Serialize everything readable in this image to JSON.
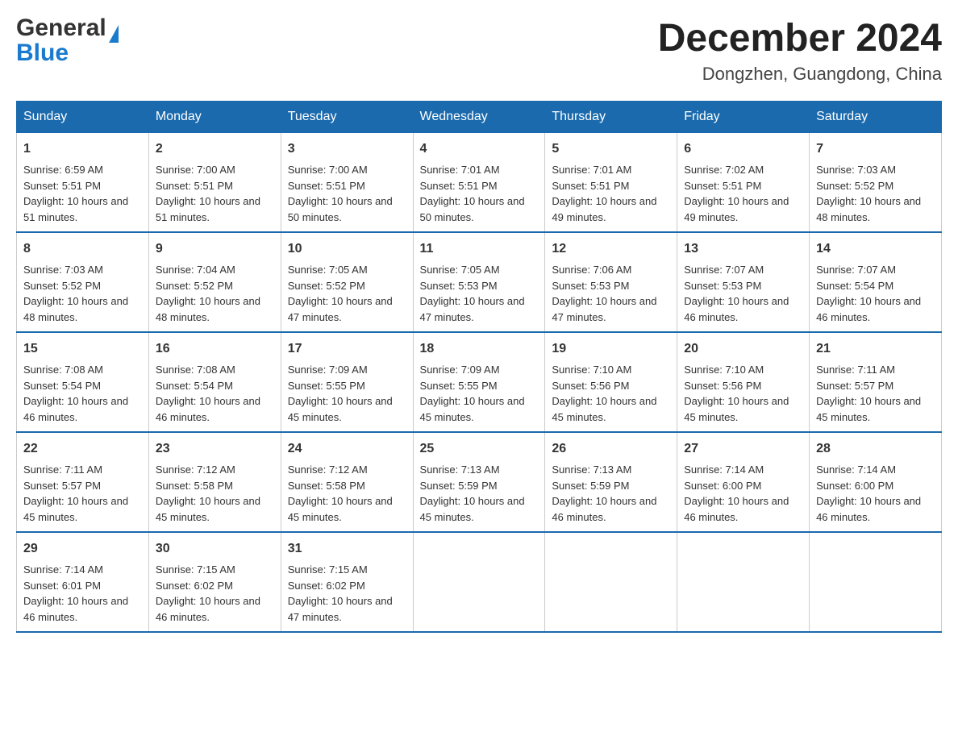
{
  "header": {
    "month_title": "December 2024",
    "location": "Dongzhen, Guangdong, China",
    "logo_general": "General",
    "logo_blue": "Blue"
  },
  "days_of_week": [
    "Sunday",
    "Monday",
    "Tuesday",
    "Wednesday",
    "Thursday",
    "Friday",
    "Saturday"
  ],
  "weeks": [
    [
      {
        "day": "1",
        "sunrise": "Sunrise: 6:59 AM",
        "sunset": "Sunset: 5:51 PM",
        "daylight": "Daylight: 10 hours and 51 minutes."
      },
      {
        "day": "2",
        "sunrise": "Sunrise: 7:00 AM",
        "sunset": "Sunset: 5:51 PM",
        "daylight": "Daylight: 10 hours and 51 minutes."
      },
      {
        "day": "3",
        "sunrise": "Sunrise: 7:00 AM",
        "sunset": "Sunset: 5:51 PM",
        "daylight": "Daylight: 10 hours and 50 minutes."
      },
      {
        "day": "4",
        "sunrise": "Sunrise: 7:01 AM",
        "sunset": "Sunset: 5:51 PM",
        "daylight": "Daylight: 10 hours and 50 minutes."
      },
      {
        "day": "5",
        "sunrise": "Sunrise: 7:01 AM",
        "sunset": "Sunset: 5:51 PM",
        "daylight": "Daylight: 10 hours and 49 minutes."
      },
      {
        "day": "6",
        "sunrise": "Sunrise: 7:02 AM",
        "sunset": "Sunset: 5:51 PM",
        "daylight": "Daylight: 10 hours and 49 minutes."
      },
      {
        "day": "7",
        "sunrise": "Sunrise: 7:03 AM",
        "sunset": "Sunset: 5:52 PM",
        "daylight": "Daylight: 10 hours and 48 minutes."
      }
    ],
    [
      {
        "day": "8",
        "sunrise": "Sunrise: 7:03 AM",
        "sunset": "Sunset: 5:52 PM",
        "daylight": "Daylight: 10 hours and 48 minutes."
      },
      {
        "day": "9",
        "sunrise": "Sunrise: 7:04 AM",
        "sunset": "Sunset: 5:52 PM",
        "daylight": "Daylight: 10 hours and 48 minutes."
      },
      {
        "day": "10",
        "sunrise": "Sunrise: 7:05 AM",
        "sunset": "Sunset: 5:52 PM",
        "daylight": "Daylight: 10 hours and 47 minutes."
      },
      {
        "day": "11",
        "sunrise": "Sunrise: 7:05 AM",
        "sunset": "Sunset: 5:53 PM",
        "daylight": "Daylight: 10 hours and 47 minutes."
      },
      {
        "day": "12",
        "sunrise": "Sunrise: 7:06 AM",
        "sunset": "Sunset: 5:53 PM",
        "daylight": "Daylight: 10 hours and 47 minutes."
      },
      {
        "day": "13",
        "sunrise": "Sunrise: 7:07 AM",
        "sunset": "Sunset: 5:53 PM",
        "daylight": "Daylight: 10 hours and 46 minutes."
      },
      {
        "day": "14",
        "sunrise": "Sunrise: 7:07 AM",
        "sunset": "Sunset: 5:54 PM",
        "daylight": "Daylight: 10 hours and 46 minutes."
      }
    ],
    [
      {
        "day": "15",
        "sunrise": "Sunrise: 7:08 AM",
        "sunset": "Sunset: 5:54 PM",
        "daylight": "Daylight: 10 hours and 46 minutes."
      },
      {
        "day": "16",
        "sunrise": "Sunrise: 7:08 AM",
        "sunset": "Sunset: 5:54 PM",
        "daylight": "Daylight: 10 hours and 46 minutes."
      },
      {
        "day": "17",
        "sunrise": "Sunrise: 7:09 AM",
        "sunset": "Sunset: 5:55 PM",
        "daylight": "Daylight: 10 hours and 45 minutes."
      },
      {
        "day": "18",
        "sunrise": "Sunrise: 7:09 AM",
        "sunset": "Sunset: 5:55 PM",
        "daylight": "Daylight: 10 hours and 45 minutes."
      },
      {
        "day": "19",
        "sunrise": "Sunrise: 7:10 AM",
        "sunset": "Sunset: 5:56 PM",
        "daylight": "Daylight: 10 hours and 45 minutes."
      },
      {
        "day": "20",
        "sunrise": "Sunrise: 7:10 AM",
        "sunset": "Sunset: 5:56 PM",
        "daylight": "Daylight: 10 hours and 45 minutes."
      },
      {
        "day": "21",
        "sunrise": "Sunrise: 7:11 AM",
        "sunset": "Sunset: 5:57 PM",
        "daylight": "Daylight: 10 hours and 45 minutes."
      }
    ],
    [
      {
        "day": "22",
        "sunrise": "Sunrise: 7:11 AM",
        "sunset": "Sunset: 5:57 PM",
        "daylight": "Daylight: 10 hours and 45 minutes."
      },
      {
        "day": "23",
        "sunrise": "Sunrise: 7:12 AM",
        "sunset": "Sunset: 5:58 PM",
        "daylight": "Daylight: 10 hours and 45 minutes."
      },
      {
        "day": "24",
        "sunrise": "Sunrise: 7:12 AM",
        "sunset": "Sunset: 5:58 PM",
        "daylight": "Daylight: 10 hours and 45 minutes."
      },
      {
        "day": "25",
        "sunrise": "Sunrise: 7:13 AM",
        "sunset": "Sunset: 5:59 PM",
        "daylight": "Daylight: 10 hours and 45 minutes."
      },
      {
        "day": "26",
        "sunrise": "Sunrise: 7:13 AM",
        "sunset": "Sunset: 5:59 PM",
        "daylight": "Daylight: 10 hours and 46 minutes."
      },
      {
        "day": "27",
        "sunrise": "Sunrise: 7:14 AM",
        "sunset": "Sunset: 6:00 PM",
        "daylight": "Daylight: 10 hours and 46 minutes."
      },
      {
        "day": "28",
        "sunrise": "Sunrise: 7:14 AM",
        "sunset": "Sunset: 6:00 PM",
        "daylight": "Daylight: 10 hours and 46 minutes."
      }
    ],
    [
      {
        "day": "29",
        "sunrise": "Sunrise: 7:14 AM",
        "sunset": "Sunset: 6:01 PM",
        "daylight": "Daylight: 10 hours and 46 minutes."
      },
      {
        "day": "30",
        "sunrise": "Sunrise: 7:15 AM",
        "sunset": "Sunset: 6:02 PM",
        "daylight": "Daylight: 10 hours and 46 minutes."
      },
      {
        "day": "31",
        "sunrise": "Sunrise: 7:15 AM",
        "sunset": "Sunset: 6:02 PM",
        "daylight": "Daylight: 10 hours and 47 minutes."
      },
      {
        "day": "",
        "sunrise": "",
        "sunset": "",
        "daylight": ""
      },
      {
        "day": "",
        "sunrise": "",
        "sunset": "",
        "daylight": ""
      },
      {
        "day": "",
        "sunrise": "",
        "sunset": "",
        "daylight": ""
      },
      {
        "day": "",
        "sunrise": "",
        "sunset": "",
        "daylight": ""
      }
    ]
  ]
}
